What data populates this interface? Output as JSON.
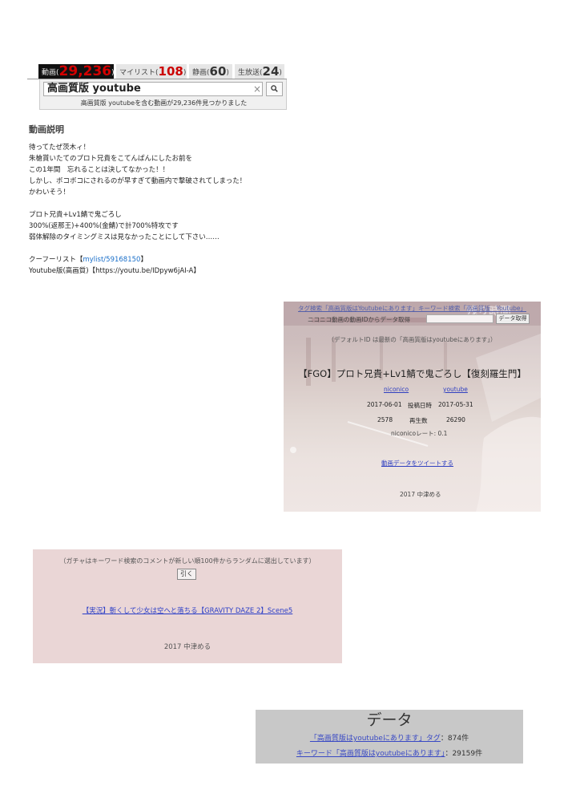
{
  "search": {
    "tabs": [
      {
        "label": "動画",
        "count": "29,236"
      },
      {
        "label": "マイリスト",
        "count": "108"
      },
      {
        "label": "静画",
        "count": "60"
      },
      {
        "label": "生放送",
        "count": "24"
      }
    ],
    "query": "高画質版 youtube",
    "clear_symbol": "×",
    "search_symbol": "🔍",
    "result_note": "高画質版 youtubeを含む動画が29,236件見つかりました"
  },
  "description": {
    "heading": "動画説明",
    "lines": [
      "待ってたぜ茨木ィ！",
      "朱槍貰いたてのプロト兄貴をこてんぱんにしたお前を",
      "この1年間　忘れることは決してなかった！！",
      "しかし、ボコボコにされるのが早すぎて動画内で撃破されてしまった！",
      "かわいそう！",
      "",
      "プロト兄貴+Lv1鯖で鬼ごろし",
      "300%(返那王)+400%(金鯖)で計700%特攻です",
      "弱体解除のタイミングミスは見なかったことにして下さい……",
      "",
      "クーフーリスト【",
      "Youtube版(高画質)【https://youtu.be/IDpyw6jAI-A】"
    ],
    "mylist_link": "mylist/59168150",
    "mylist_suffix": "】"
  },
  "data_panel": {
    "overlay_text": "残り時間",
    "top_links": "タグ検索「高画質版はYoutubeにあります」キーワード検索「高画質版　Youtube」",
    "id_label": "ニコニコ動画の動画IDからデータ取得",
    "fetch_button": "データ取得",
    "note": "（デフォルトID は最新の「高画質版はyoutubeにあります」）",
    "title": "【FGO】プロト兄貴+Lv1鯖で鬼ごろし【復刻羅生門】",
    "site_left": "niconico",
    "site_right": "youtube",
    "date_left": "2017-06-01",
    "date_label": "投稿日時",
    "date_right": "2017-05-31",
    "views_left": "2578",
    "views_label": "再生数",
    "views_right": "26290",
    "rate": "niconicoレート: 0.1",
    "tweet_link": "動画データをツイートする",
    "credit": "2017 中津める"
  },
  "gacha": {
    "note": "（ガチャはキーワード検索のコメントが新しい順100件からランダムに選出しています）",
    "draw_button": "引く",
    "result_link": "【実況】斬くして少女は空へと落ちる【GRAVITY DAZE 2】Scene5",
    "credit": "2017 中津める"
  },
  "data_box": {
    "heading": "データ",
    "tag_link": "「高画質版はyoutubeにあります」タグ",
    "tag_count": "：874件",
    "keyword_link": "キーワード「高画質版はyoutubeにあります」",
    "keyword_count": "：29159件"
  },
  "colors": {
    "count_red": "#d40000",
    "link_blue": "#3040c0",
    "gacha_bg": "#ead6d6",
    "data_box_bg": "#c8c8c8"
  }
}
